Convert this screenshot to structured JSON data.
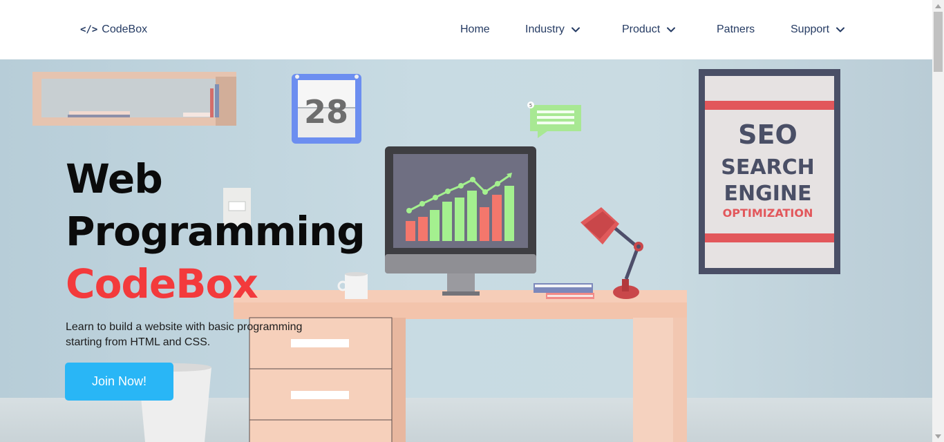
{
  "nav": {
    "brand_icon": "</>",
    "brand_name": "CodeBox",
    "items": [
      {
        "label": "Home",
        "dropdown": false
      },
      {
        "label": "Industry",
        "dropdown": true
      },
      {
        "label": "Product",
        "dropdown": true
      },
      {
        "label": "Patners",
        "dropdown": false
      },
      {
        "label": "Support",
        "dropdown": true
      }
    ]
  },
  "hero": {
    "title_line1": "Web",
    "title_line2": "Programming",
    "title_accent": "CodeBox",
    "description": "Learn to build a website with basic programming starting from HTML and CSS.",
    "cta_label": "Join Now!",
    "illustration": {
      "calendar_day": "28",
      "poster_line1": "SEO",
      "poster_line2": "SEARCH",
      "poster_line3": "ENGINE",
      "poster_line4": "OPTIMIZATION",
      "chat_badge": "5"
    }
  },
  "colors": {
    "nav_text": "#253b63",
    "accent_red": "#f33a3c",
    "button_blue": "#29b6f6",
    "wall": "#c4d6df"
  }
}
